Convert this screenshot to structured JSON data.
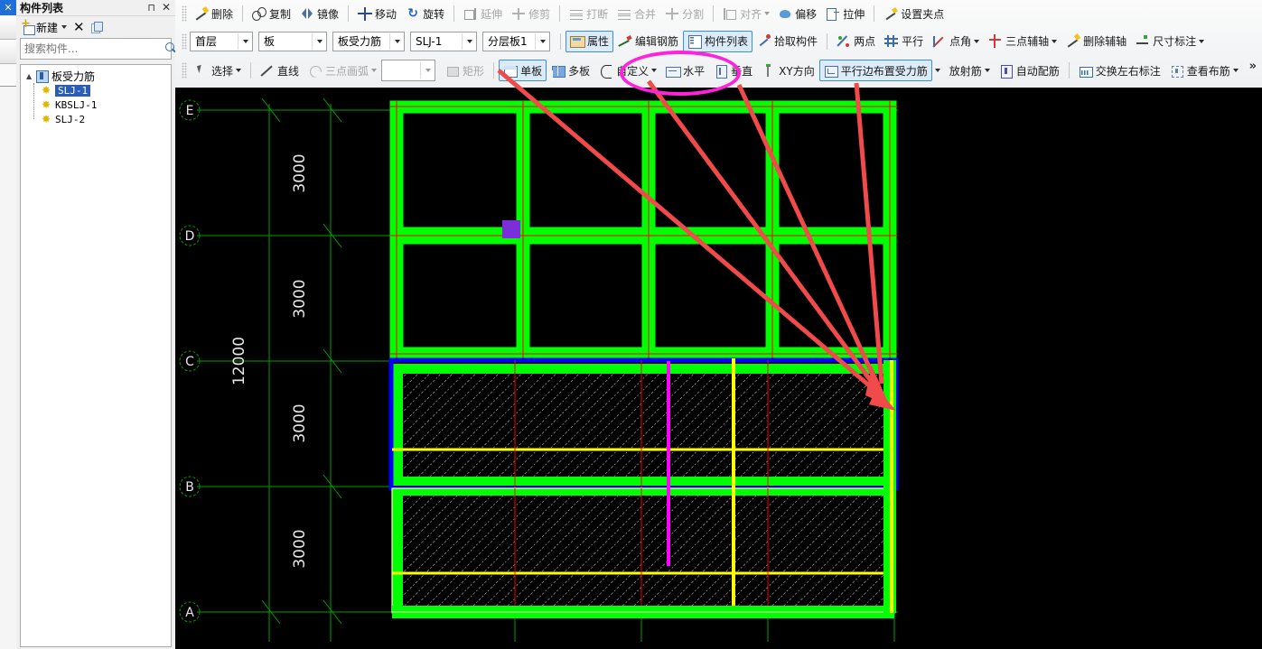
{
  "window": {
    "close_icon": "✕"
  },
  "panel": {
    "title": "构件列表",
    "pin_icon": "⊓",
    "close_icon": "✕",
    "toolbar": {
      "new_label": "新建",
      "new_icon": "new-icon",
      "delete_icon": "delete-x-icon",
      "copy_icon": "copy-icon"
    },
    "search": {
      "placeholder": "搜索构件...",
      "value": "",
      "icon": "search-icon"
    },
    "tree": {
      "root": {
        "label": "板受力筋",
        "icon": "folder-rebar-icon",
        "expander": "▲"
      },
      "children": [
        {
          "label": "SLJ-1",
          "icon": "gear-icon",
          "selected": true
        },
        {
          "label": "KBSLJ-1",
          "icon": "gear-icon",
          "selected": false
        },
        {
          "label": "SLJ-2",
          "icon": "gear-icon",
          "selected": false
        }
      ]
    }
  },
  "toolbar_row1": [
    {
      "label": "删除",
      "icon": "eraser-icon",
      "enabled": true,
      "dropdown": false
    },
    {
      "label": "复制",
      "icon": "copy-icon",
      "enabled": true,
      "dropdown": false
    },
    {
      "label": "镜像",
      "icon": "mirror-icon",
      "enabled": true,
      "dropdown": false
    },
    {
      "label": "移动",
      "icon": "move-icon",
      "enabled": true,
      "dropdown": false
    },
    {
      "label": "旋转",
      "icon": "rotate-icon",
      "enabled": true,
      "dropdown": false
    },
    {
      "label": "延伸",
      "icon": "extend-icon",
      "enabled": false,
      "dropdown": false
    },
    {
      "label": "修剪",
      "icon": "trim-icon",
      "enabled": false,
      "dropdown": false
    },
    {
      "label": "打断",
      "icon": "break-icon",
      "enabled": false,
      "dropdown": false
    },
    {
      "label": "合并",
      "icon": "merge-icon",
      "enabled": false,
      "dropdown": false
    },
    {
      "label": "分割",
      "icon": "split-icon",
      "enabled": false,
      "dropdown": false
    },
    {
      "label": "对齐",
      "icon": "align-icon",
      "enabled": false,
      "dropdown": true
    },
    {
      "label": "偏移",
      "icon": "offset-icon",
      "enabled": true,
      "dropdown": false
    },
    {
      "label": "拉伸",
      "icon": "stretch-icon",
      "enabled": true,
      "dropdown": false
    },
    {
      "label": "设置夹点",
      "icon": "set-grip-icon",
      "enabled": true,
      "dropdown": false
    }
  ],
  "toolbar_row2": {
    "combos": [
      {
        "name": "floor-select",
        "value": "首层"
      },
      {
        "name": "category-select",
        "value": "板"
      },
      {
        "name": "component-type-select",
        "value": "板受力筋"
      },
      {
        "name": "component-select",
        "value": "SLJ-1"
      },
      {
        "name": "layer-select",
        "value": "分层板1"
      }
    ],
    "buttons": [
      {
        "label": "属性",
        "icon": "properties-icon",
        "active": true,
        "dropdown": false
      },
      {
        "label": "编辑钢筋",
        "icon": "edit-rebar-icon",
        "active": false,
        "dropdown": false
      },
      {
        "label": "构件列表",
        "icon": "component-list-icon",
        "active": true,
        "dropdown": false
      },
      {
        "label": "拾取构件",
        "icon": "pick-component-icon",
        "active": false,
        "dropdown": false
      },
      {
        "label": "两点",
        "icon": "two-point-icon",
        "active": false,
        "dropdown": false
      },
      {
        "label": "平行",
        "icon": "parallel-icon",
        "active": false,
        "dropdown": false
      },
      {
        "label": "点角",
        "icon": "point-angle-icon",
        "active": false,
        "dropdown": true
      },
      {
        "label": "三点辅轴",
        "icon": "three-point-axis-icon",
        "active": false,
        "dropdown": true
      },
      {
        "label": "删除辅轴",
        "icon": "delete-axis-icon",
        "active": false,
        "dropdown": false
      },
      {
        "label": "尺寸标注",
        "icon": "dimension-icon",
        "active": false,
        "dropdown": true
      }
    ]
  },
  "toolbar_row3": {
    "buttons_left": [
      {
        "label": "选择",
        "icon": "cursor-icon",
        "enabled": true,
        "active": false,
        "dropdown": true
      },
      {
        "label": "直线",
        "icon": "line-icon",
        "enabled": true,
        "active": false,
        "dropdown": false
      },
      {
        "label": "三点画弧",
        "icon": "arc-icon",
        "enabled": false,
        "active": false,
        "dropdown": true
      }
    ],
    "empty_combo": {
      "name": "shape-combo",
      "value": ""
    },
    "buttons_right": [
      {
        "label": "矩形",
        "icon": "rectangle-icon",
        "enabled": false,
        "active": false,
        "dropdown": false
      },
      {
        "label": "单板",
        "icon": "single-slab-icon",
        "enabled": true,
        "active": true,
        "dropdown": false
      },
      {
        "label": "多板",
        "icon": "multi-slab-icon",
        "enabled": true,
        "active": false,
        "dropdown": false
      },
      {
        "label": "自定义",
        "icon": "custom-icon",
        "enabled": true,
        "active": false,
        "dropdown": true
      },
      {
        "label": "水平",
        "icon": "horizontal-icon",
        "enabled": true,
        "active": false,
        "dropdown": false
      },
      {
        "label": "垂直",
        "icon": "vertical-icon",
        "enabled": true,
        "active": false,
        "dropdown": false
      },
      {
        "label": "XY方向",
        "icon": "xy-direction-icon",
        "enabled": true,
        "active": false,
        "dropdown": false
      },
      {
        "label": "平行边布置受力筋",
        "icon": "parallel-edge-rebar-icon",
        "enabled": true,
        "active": true,
        "dropdown": true
      },
      {
        "label": "放射筋",
        "icon": "radial-rebar-icon",
        "enabled": true,
        "active": false,
        "dropdown": true
      },
      {
        "label": "自动配筋",
        "icon": "auto-rebar-icon",
        "enabled": true,
        "active": false,
        "dropdown": false
      },
      {
        "label": "交换左右标注",
        "icon": "swap-label-icon",
        "enabled": true,
        "active": false,
        "dropdown": false
      },
      {
        "label": "查看布筋",
        "icon": "view-rebar-icon",
        "enabled": true,
        "active": false,
        "dropdown": true
      }
    ],
    "overflow_label": "»"
  },
  "annotations": {
    "highlight_ellipse": {
      "targets": [
        "水平",
        "垂直"
      ],
      "color": "#ff22dd"
    },
    "arrow_color": "#f04a4a",
    "arrow_count": 4,
    "arrow_target": "right-edge-vertical-rebar"
  },
  "canvas": {
    "background": "#000000",
    "grid_labels_vertical": [
      "E",
      "D",
      "C",
      "B",
      "A"
    ],
    "dimensions": {
      "segments": [
        "3000",
        "3000",
        "3000",
        "3000"
      ],
      "total": "12000"
    },
    "colors": {
      "grid_line": "#00a000",
      "beam": "#00ff00",
      "beam_centerline": "#ff0000",
      "column": "#7a2fd8",
      "slab_hatch": "#d8d8d8",
      "rebar_selected": "#ffff00",
      "slab_outline_selected": "#0000ff",
      "rebar_magenta": "#ff00ff",
      "axis_label": "#00c000",
      "dim_text": "#e8e8e8"
    }
  }
}
